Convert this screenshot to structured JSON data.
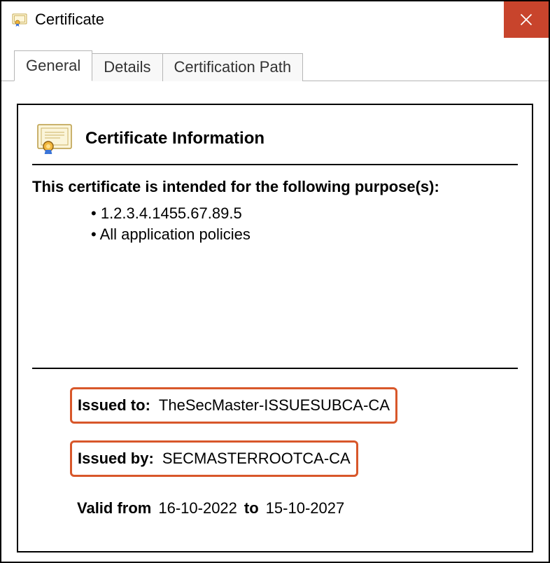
{
  "window": {
    "title": "Certificate"
  },
  "tabs": {
    "general": "General",
    "details": "Details",
    "certpath": "Certification Path"
  },
  "cert": {
    "header": "Certificate Information",
    "intent": "This certificate is intended for the following purpose(s):",
    "purposes": {
      "p0": "1.2.3.4.1455.67.89.5",
      "p1": "All application policies"
    },
    "issued_to_label": "Issued to:",
    "issued_to_value": "TheSecMaster-ISSUESUBCA-CA",
    "issued_by_label": "Issued by:",
    "issued_by_value": "SECMASTERROOTCA-CA",
    "valid_from_label": "Valid from",
    "valid_from_value": "16-10-2022",
    "valid_to_label": "to",
    "valid_to_value": "15-10-2027"
  }
}
